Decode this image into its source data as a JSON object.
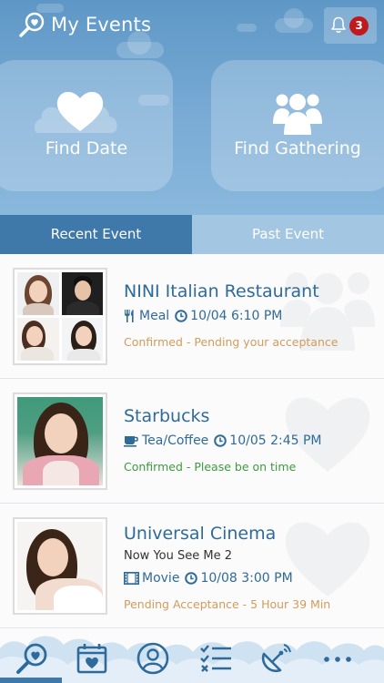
{
  "header": {
    "title": "My Events",
    "notification_count": "3"
  },
  "quick_actions": [
    {
      "label": "Find Date",
      "icon": "heart-icon"
    },
    {
      "label": "Find Gathering",
      "icon": "people-icon"
    }
  ],
  "tabs": [
    {
      "label": "Recent Event",
      "active": true
    },
    {
      "label": "Past Event",
      "active": false
    }
  ],
  "events": [
    {
      "title": "NINI Italian Restaurant",
      "subtitle": "",
      "category": "Meal",
      "category_icon": "fork-knife-icon",
      "datetime": "10/04 6:10 PM",
      "status": "Confirmed - Pending your acceptance",
      "status_color": "#d39b5b"
    },
    {
      "title": "Starbucks",
      "subtitle": "",
      "category": "Tea/Coffee",
      "category_icon": "coffee-cup-icon",
      "datetime": "10/05 2:45 PM",
      "status": "Confirmed - Please be on time",
      "status_color": "#3d9b3d"
    },
    {
      "title": "Universal Cinema",
      "subtitle": "Now You See Me 2",
      "category": "Movie",
      "category_icon": "film-icon",
      "datetime": "10/08 3:00 PM",
      "status": "Pending Acceptance - 5 Hour 39 Min",
      "status_color": "#d39b5b"
    }
  ],
  "bottom_nav": [
    {
      "icon": "my-events-icon",
      "active": true
    },
    {
      "icon": "calendar-heart-icon",
      "active": false
    },
    {
      "icon": "profile-icon",
      "active": false
    },
    {
      "icon": "checklist-icon",
      "active": false
    },
    {
      "icon": "satellite-dish-icon",
      "active": false
    },
    {
      "icon": "more-icon",
      "active": false
    }
  ],
  "colors": {
    "accent": "#3f79a9",
    "title_blue": "#2f6b9a",
    "pending": "#d39b5b",
    "confirmed": "#3d9b3d",
    "badge": "#c0191e"
  }
}
